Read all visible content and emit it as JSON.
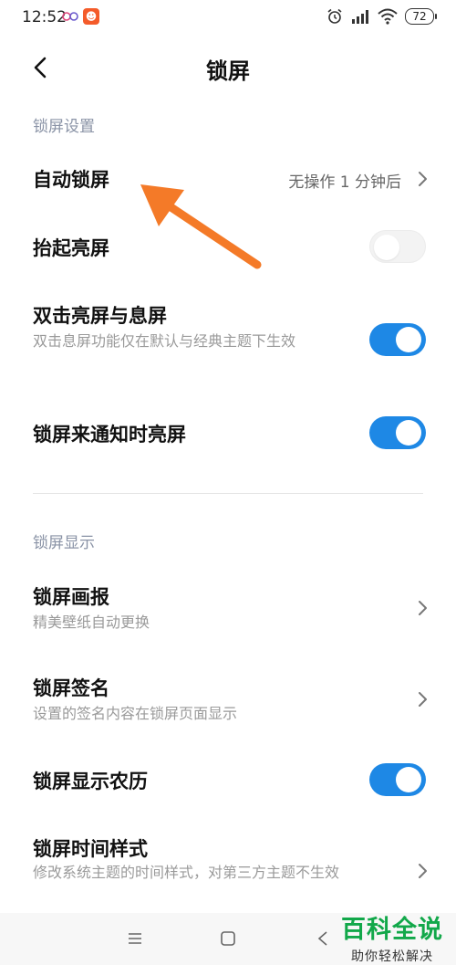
{
  "status_bar": {
    "time": "12:52",
    "battery": "72",
    "icons": [
      "people-app-icon",
      "app-notification-icon",
      "alarm-icon",
      "hd-signal-icon",
      "wifi-icon",
      "battery-icon"
    ]
  },
  "header": {
    "title": "锁屏",
    "back_icon": "chevron-left-icon"
  },
  "sections": {
    "lock_settings": {
      "label": "锁屏设置",
      "items": [
        {
          "title": "自动锁屏",
          "value": "无操作 1 分钟后",
          "control": "chevron"
        },
        {
          "title": "抬起亮屏",
          "control": "toggle",
          "on": false
        },
        {
          "title": "双击亮屏与息屏",
          "subtitle": "双击息屏功能仅在默认与经典主题下生效",
          "control": "toggle",
          "on": true
        },
        {
          "title": "锁屏来通知时亮屏",
          "control": "toggle",
          "on": true
        }
      ]
    },
    "lock_display": {
      "label": "锁屏显示",
      "items": [
        {
          "title": "锁屏画报",
          "subtitle": "精美壁纸自动更换",
          "control": "chevron"
        },
        {
          "title": "锁屏签名",
          "subtitle": "设置的签名内容在锁屏页面显示",
          "control": "chevron"
        },
        {
          "title": "锁屏显示农历",
          "control": "toggle",
          "on": true
        },
        {
          "title": "锁屏时间样式",
          "subtitle": "修改系统主题的时间样式，对第三方主题不生效",
          "control": "chevron"
        }
      ]
    }
  },
  "watermark": {
    "title": "百科全说",
    "subtitle": "助你轻松解决"
  },
  "colors": {
    "accent": "#1e88e5",
    "section_label": "#8a93a6",
    "arrow": "#f47a28",
    "watermark": "#12a84a"
  }
}
